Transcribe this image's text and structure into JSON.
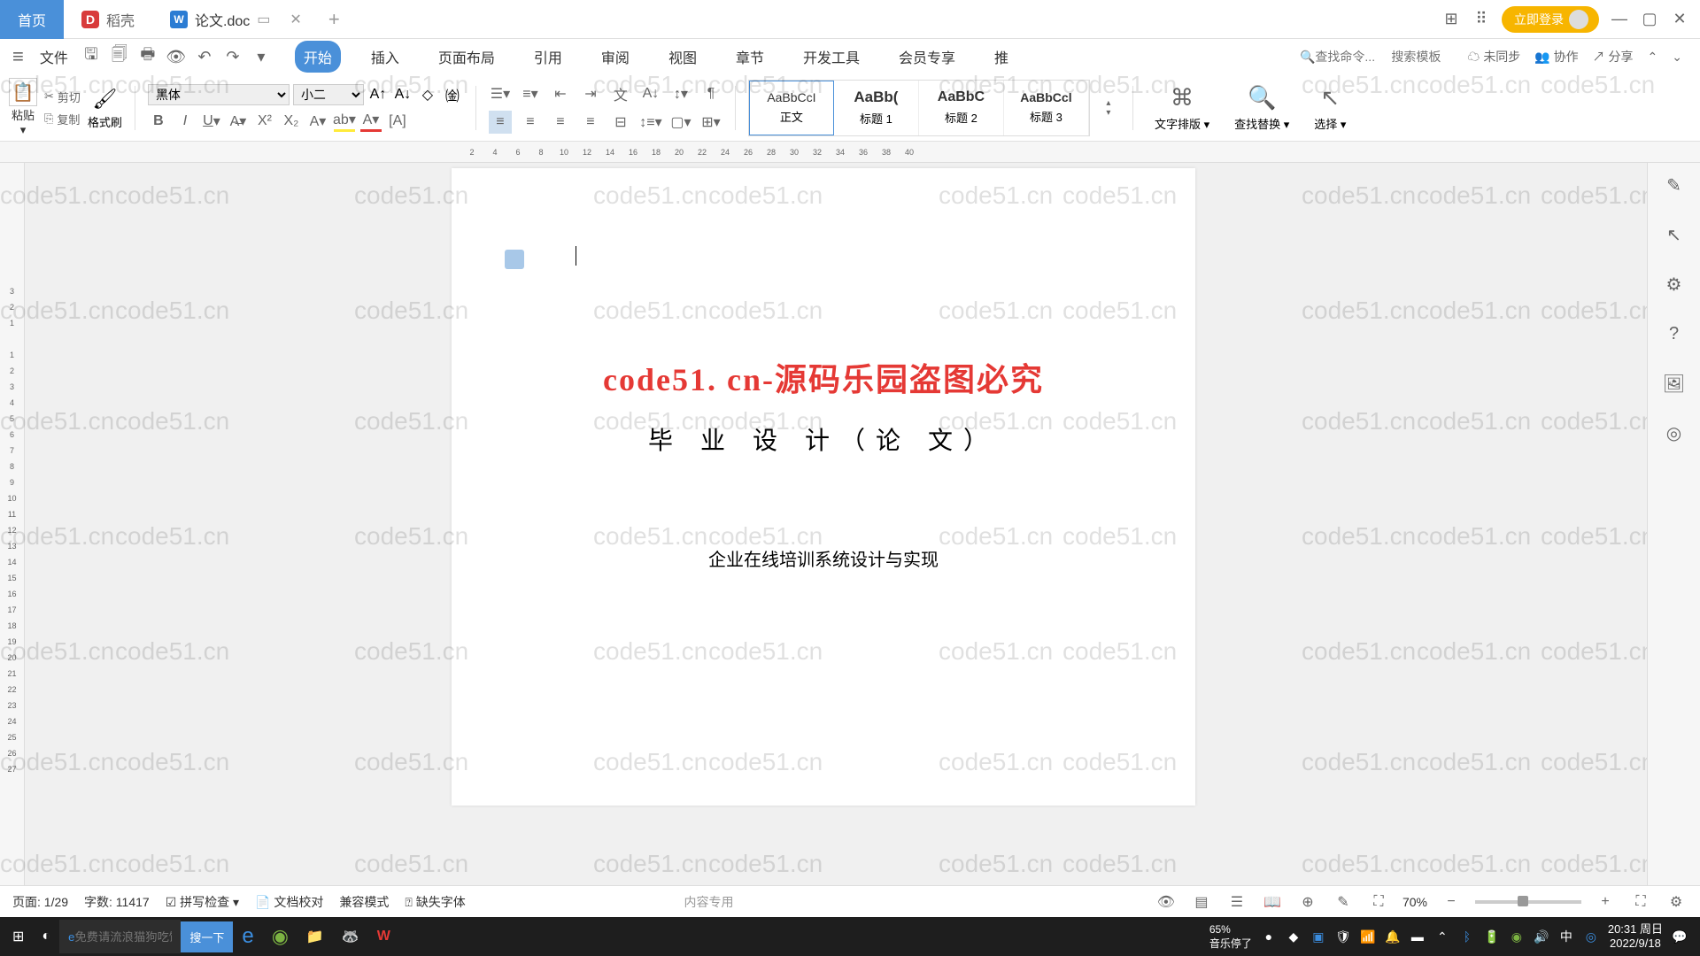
{
  "tabs": {
    "home": "首页",
    "doke": "稻壳",
    "doc": "论文.doc"
  },
  "login": "立即登录",
  "file_menu": "文件",
  "main_tabs": [
    "开始",
    "插入",
    "页面布局",
    "引用",
    "审阅",
    "视图",
    "章节",
    "开发工具",
    "会员专享",
    "推"
  ],
  "search": {
    "cmd": "查找命令...",
    "template": "搜索模板"
  },
  "right_tools": {
    "sync": "未同步",
    "collab": "协作",
    "share": "分享"
  },
  "clipboard": {
    "paste": "粘贴",
    "cut": "剪切",
    "copy": "复制",
    "brush": "格式刷"
  },
  "font": {
    "name": "黑体",
    "size": "小二"
  },
  "styles": [
    {
      "preview": "AaBbCcI",
      "name": "正文"
    },
    {
      "preview": "AaBb(",
      "name": "标题 1",
      "bold": true
    },
    {
      "preview": "AaBbC",
      "name": "标题 2",
      "bold": true
    },
    {
      "preview": "AaBbCcl",
      "name": "标题 3",
      "bold": true
    }
  ],
  "big_buttons": {
    "layout": "文字排版",
    "replace": "查找替换",
    "select": "选择"
  },
  "document": {
    "watermark_red": "code51. cn-源码乐园盗图必究",
    "title": "毕 业 设 计（论 文）",
    "subtitle": "企业在线培训系统设计与实现"
  },
  "watermark_text": "code51.cn",
  "status": {
    "page": "页面: 1/29",
    "words": "字数: 11417",
    "spell": "拼写检查",
    "proof": "文档校对",
    "compat": "兼容模式",
    "missing_font": "缺失字体",
    "zoom": "70%",
    "center_msg": "内容专用"
  },
  "taskbar": {
    "search_placeholder": "免费请流浪猫狗吃饭",
    "search_btn": "搜一下",
    "ime": "中",
    "time": "20:31 周日",
    "date": "2022/9/18",
    "audio": "音乐停了",
    "percent": "65%"
  },
  "ruler_h": [
    "2",
    "4",
    "6",
    "8",
    "10",
    "12",
    "14",
    "16",
    "18",
    "20",
    "22",
    "24",
    "26",
    "28",
    "30",
    "32",
    "34",
    "36",
    "38",
    "40"
  ],
  "ruler_v": [
    "3",
    "2",
    "1",
    "",
    "1",
    "2",
    "3",
    "4",
    "5",
    "6",
    "7",
    "8",
    "9",
    "10",
    "11",
    "12",
    "13",
    "14",
    "15",
    "16",
    "17",
    "18",
    "19",
    "20",
    "21",
    "22",
    "23",
    "24",
    "25",
    "26",
    "27"
  ]
}
